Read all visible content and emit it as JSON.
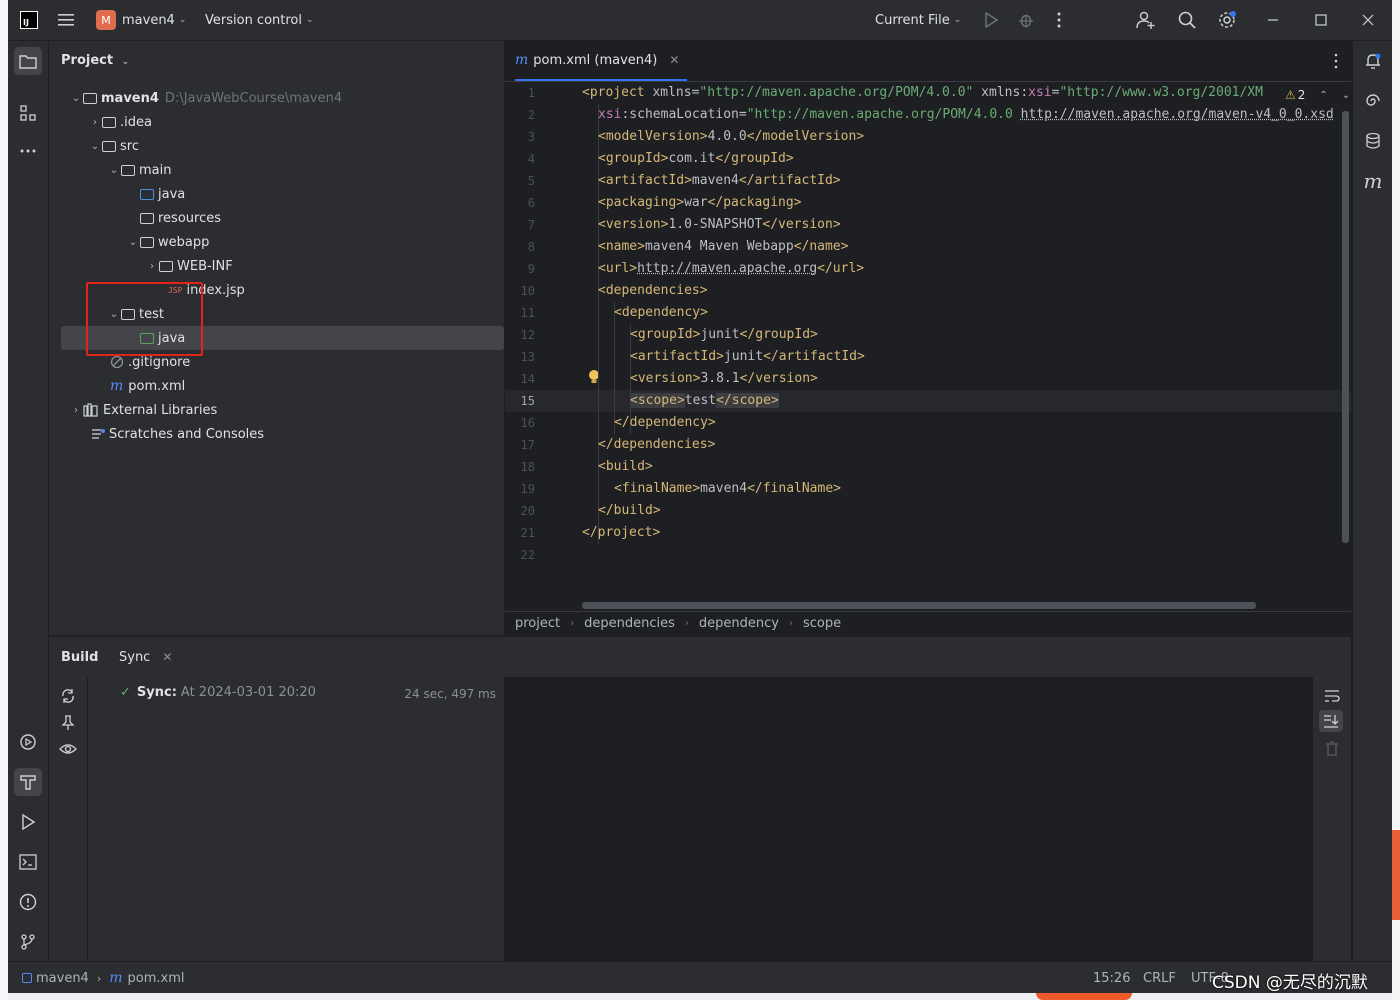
{
  "titlebar": {
    "logo": "IJ",
    "project_badge": "M",
    "project_name": "maven4",
    "version_control": "Version control",
    "run_config": "Current File"
  },
  "project_panel": {
    "title": "Project",
    "tree": [
      {
        "label": "maven4",
        "hint": "D:\\JavaWebCourse\\maven4"
      },
      {
        "label": ".idea"
      },
      {
        "label": "src"
      },
      {
        "label": "main"
      },
      {
        "label": "java"
      },
      {
        "label": "resources"
      },
      {
        "label": "webapp"
      },
      {
        "label": "WEB-INF"
      },
      {
        "label": "index.jsp",
        "badge": "JSP"
      },
      {
        "label": "test"
      },
      {
        "label": "java"
      },
      {
        "label": ".gitignore"
      },
      {
        "label": "pom.xml",
        "badge": "m"
      },
      {
        "label": "External Libraries"
      },
      {
        "label": "Scratches and Consoles"
      }
    ]
  },
  "editor": {
    "tab_label": "pom.xml (maven4)",
    "tab_icon": "m",
    "warning_count": "2",
    "current_line": "15",
    "line_numbers": [
      "1",
      "2",
      "3",
      "4",
      "5",
      "6",
      "7",
      "8",
      "9",
      "10",
      "11",
      "12",
      "13",
      "14",
      "15",
      "16",
      "17",
      "18",
      "19",
      "20",
      "21",
      "22"
    ],
    "lines": {
      "l1a": "<project",
      "l1b": " xmlns=",
      "l1c": "\"http://maven.apache.org/POM/4.0.0\"",
      "l1d": " xmlns:",
      "l1e": "xsi",
      "l1f": "=",
      "l1g": "\"http://www.w3.org/2001/XM",
      "l2a": "xsi",
      "l2b": ":schemaLocation=",
      "l2c": "\"http://maven.apache.org/POM/4.0.0 ",
      "l2d": "http://maven.apache.org/maven-v4_0_0.xsd",
      "l3a": "<modelVersion>",
      "l3b": "4.0.0",
      "l3c": "</modelVersion>",
      "l4a": "<groupId>",
      "l4b": "com.it",
      "l4c": "</groupId>",
      "l5a": "<artifactId>",
      "l5b": "maven4",
      "l5c": "</artifactId>",
      "l6a": "<packaging>",
      "l6b": "war",
      "l6c": "</packaging>",
      "l7a": "<version>",
      "l7b": "1.0-SNAPSHOT",
      "l7c": "</version>",
      "l8a": "<name>",
      "l8b": "maven4 Maven Webapp",
      "l8c": "</name>",
      "l9a": "<url>",
      "l9b": "http://maven.apache.org",
      "l9c": "</url>",
      "l10": "<dependencies>",
      "l11": "<dependency>",
      "l12a": "<groupId>",
      "l12b": "junit",
      "l12c": "</groupId>",
      "l13a": "<artifactId>",
      "l13b": "junit",
      "l13c": "</artifactId>",
      "l14a": "<version>",
      "l14b": "3.8.1",
      "l14c": "</version>",
      "l15a": "<scope>",
      "l15b": "test",
      "l15c": "</scope>",
      "l16": "</dependency>",
      "l17": "</dependencies>",
      "l18": "<build>",
      "l19a": "<finalName>",
      "l19b": "maven4",
      "l19c": "</finalName>",
      "l20": "</build>",
      "l21": "</project>"
    },
    "breadcrumb": [
      "project",
      "dependencies",
      "dependency",
      "scope"
    ]
  },
  "build_panel": {
    "tab_build": "Build",
    "tab_sync": "Sync",
    "sync_label": "Sync:",
    "sync_time": "At 2024-03-01 20:20",
    "sync_duration": "24 sec, 497 ms"
  },
  "statusbar": {
    "project": "maven4",
    "file": "pom.xml",
    "position": "15:26",
    "line_sep": "CRLF",
    "encoding": "UTF-8"
  },
  "watermark": "CSDN @无尽的沉默"
}
